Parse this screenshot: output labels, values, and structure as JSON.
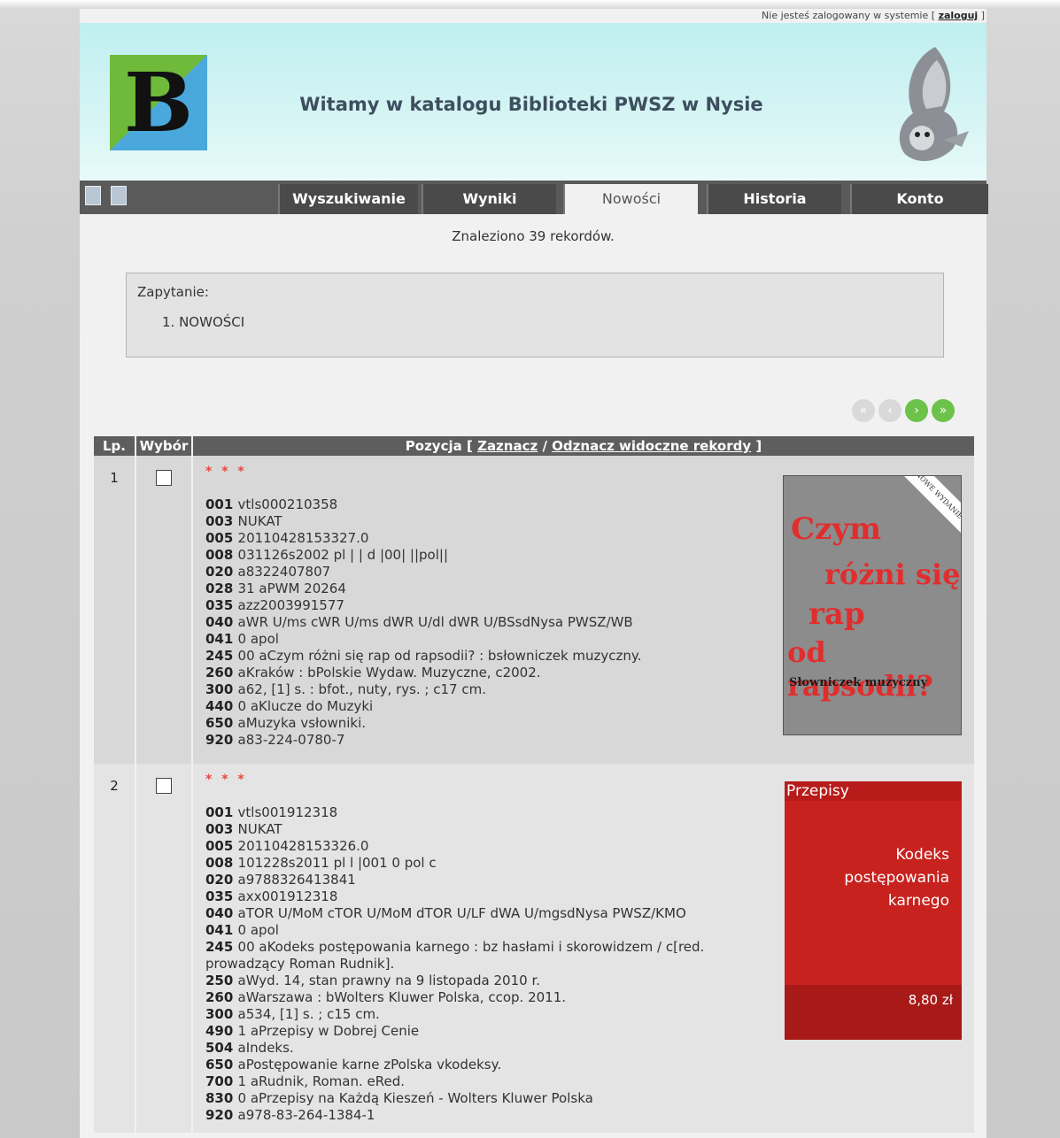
{
  "login": {
    "status": "Nie jesteś zalogowany w systemie",
    "open_bracket": "[",
    "link": "zaloguj",
    "close_bracket": "]"
  },
  "banner": {
    "logo_letter": "B",
    "title": "Witamy w katalogu Biblioteki PWSZ w Nysie"
  },
  "tabs": [
    "Wyszukiwanie",
    "Wyniki",
    "Nowości",
    "Historia",
    "Konto"
  ],
  "active_tab": "Nowości",
  "results_summary": "Znaleziono 39 rekordów.",
  "query": {
    "label": "Zapytanie:",
    "items": [
      "1. NOWOŚCI"
    ]
  },
  "table": {
    "col_lp": "Lp.",
    "col_select": "Wybór",
    "col_position": "Pozycja",
    "bracket_open": "[",
    "select_link": "Zaznacz",
    "slash": "/",
    "deselect_link": "Odznacz widoczne rekordy",
    "bracket_close": "]"
  },
  "records": [
    {
      "lp": "1",
      "stars": "* * *",
      "lines": [
        [
          "001",
          "vtls000210358"
        ],
        [
          "003",
          "NUKAT"
        ],
        [
          "005",
          "20110428153327.0"
        ],
        [
          "008",
          "031126s2002 pl | | d |00| ||pol||"
        ],
        [
          "020",
          "a8322407807"
        ],
        [
          "028",
          "31 aPWM 20264"
        ],
        [
          "035",
          "azz2003991577"
        ],
        [
          "040",
          "aWR U/ms cWR U/ms dWR U/dl dWR U/BSsdNysa PWSZ/WB"
        ],
        [
          "041",
          "0 apol"
        ],
        [
          "245",
          "00 aCzym różni się rap od rapsodii? : bsłowniczek muzyczny."
        ],
        [
          "260",
          "aKraków : bPolskie Wydaw. Muzyczne, c2002."
        ],
        [
          "300",
          "a62, [1] s. : bfot., nuty, rys. ; c17 cm."
        ],
        [
          "440",
          "0 aKlucze do Muzyki"
        ],
        [
          "650",
          "aMuzyka vsłowniki."
        ],
        [
          "920",
          "a83-224-0780-7"
        ]
      ],
      "cover": {
        "title_lines": [
          "Czym",
          "różni się",
          "rap",
          "od rapsodii?"
        ],
        "subtitle": "Słowniczek muzyczny",
        "corner": "NOWE WYDANIE"
      }
    },
    {
      "lp": "2",
      "stars": "* * *",
      "lines": [
        [
          "001",
          "vtls001912318"
        ],
        [
          "003",
          "NUKAT"
        ],
        [
          "005",
          "20110428153326.0"
        ],
        [
          "008",
          "101228s2011 pl l |001 0 pol c"
        ],
        [
          "020",
          "a9788326413841"
        ],
        [
          "035",
          "axx001912318"
        ],
        [
          "040",
          "aTOR U/MoM cTOR U/MoM dTOR U/LF dWA U/mgsdNysa PWSZ/KMO"
        ],
        [
          "041",
          "0 apol"
        ],
        [
          "245",
          "00 aKodeks postępowania karnego : bz hasłami i skorowidzem / c[red. prowadzący Roman Rudnik]."
        ],
        [
          "250",
          "aWyd. 14, stan prawny na 9 listopada 2010 r."
        ],
        [
          "260",
          "aWarszawa : bWolters Kluwer Polska, ccop. 2011."
        ],
        [
          "300",
          "a534, [1] s. ; c15 cm."
        ],
        [
          "490",
          "1 aPrzepisy w Dobrej Cenie"
        ],
        [
          "504",
          "aIndeks."
        ],
        [
          "650",
          "aPostępowanie karne zPolska vkodeksy."
        ],
        [
          "700",
          "1 aRudnik, Roman. eRed."
        ],
        [
          "830",
          "0 aPrzepisy na Każdą Kieszeń - Wolters Kluwer Polska"
        ],
        [
          "920",
          "a978-83-264-1384-1"
        ]
      ],
      "cover": {
        "series": "Przepisy",
        "title_lines": [
          "Kodeks",
          "postępowania",
          "karnego"
        ],
        "price": "8,80 zł"
      }
    }
  ]
}
